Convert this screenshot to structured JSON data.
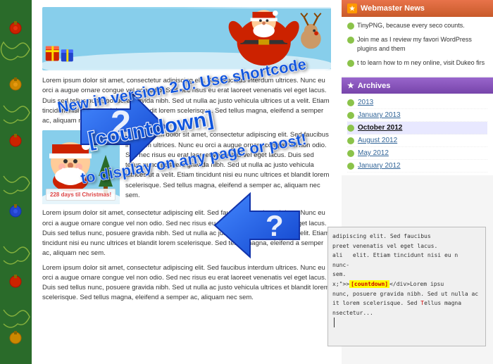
{
  "sidebar": {
    "webmaster_news": {
      "title": "Webmaster News",
      "items": [
        {
          "text": "TinyPNG, because every seco counts."
        },
        {
          "text": "Join me as I review my favori WordPress plugins and them"
        },
        {
          "text": "t to learn how to m ney online, visit Dukeo firs"
        }
      ]
    },
    "archives": {
      "title": "Archives",
      "items": [
        {
          "label": "2013",
          "active": false
        },
        {
          "label": "January 2013",
          "active": false
        },
        {
          "label": "October 2012",
          "active": true
        },
        {
          "label": "August 2012",
          "active": false
        },
        {
          "label": "May 2012",
          "active": false
        },
        {
          "label": "January 2012",
          "active": false
        }
      ]
    }
  },
  "promo": {
    "line1": "New in version 2.0: Use shortcode",
    "line2": "[countdown]",
    "line3": "to display on any page or post!"
  },
  "version": "2.0",
  "lorem": {
    "p1": "Lorem ipsum dolor sit amet, consectetur adipiscing elit. Sed faucibus interdum ultrices. Nunc eu orci a augue ornare congue vel non odio. Sed nec risus eu erat laoreet venenatis vel eget lacus. Duis sed tellus nunc, posuere gravida nibh. Sed ut nulla ac justo vehicula ultrices ut a velit. Etiam tincidunt nisi eu nunc ultrices et blandit lorem scelerisque. Sed tellus magna, eleifend a semper ac, aliquam nec sem.",
    "p2": "Lorem ipsum dolor sit amet, consectetur adipiscing elit. Sed faucibus interdum ultrices. Nunc eu orci a augue ornare congue vel non odio. Sed nec risus eu erat laoreet venenatis vel eget lacus. Duis sed tellus nunc, posuere gravida nibh. Sed ut nulla ac justo vehicula ultrices ut a velit. Etiam tincidunt nisi eu nunc ultrices et blandit lorem scelerisque. Sed tellus magna, eleifend a semper ac, aliquam nec sem.",
    "p3": "Lorem ipsum dolor sit amet, consectetur adipiscing elit. Sed faucibus interdum ultrices. Nunc eu orci a augue ornare congue vel non odio. Sed nec risus eu erat laoreet venenatis vel eget lacus. Duis sed tellus nunc, posuere gravida nibh. Sed ut nulla ac justo vehicula ultrices et blandit lorem scelerisque. Sed tellus magna, eleifend a semper ac, aliquam nec sem."
  },
  "countdown": {
    "days": "228",
    "label": "days til Christmas!"
  },
  "code_snippet": {
    "lines": [
      "adipiscing elit. Sed faucibus",
      "preet venenatis vel eget lacus.",
      "ali elit. Etiam tincidunt nisi eu n",
      "nunc-",
      "sem.",
      ">\">[countdown]</div>Lorem ipsu",
      "nunc, posuere gravida nibh. Sed ut nulla ac",
      "it lorem scelerisque. Sed Tellus magna",
      "nsectetur..."
    ],
    "shortcode_tag": "[countdown]"
  }
}
